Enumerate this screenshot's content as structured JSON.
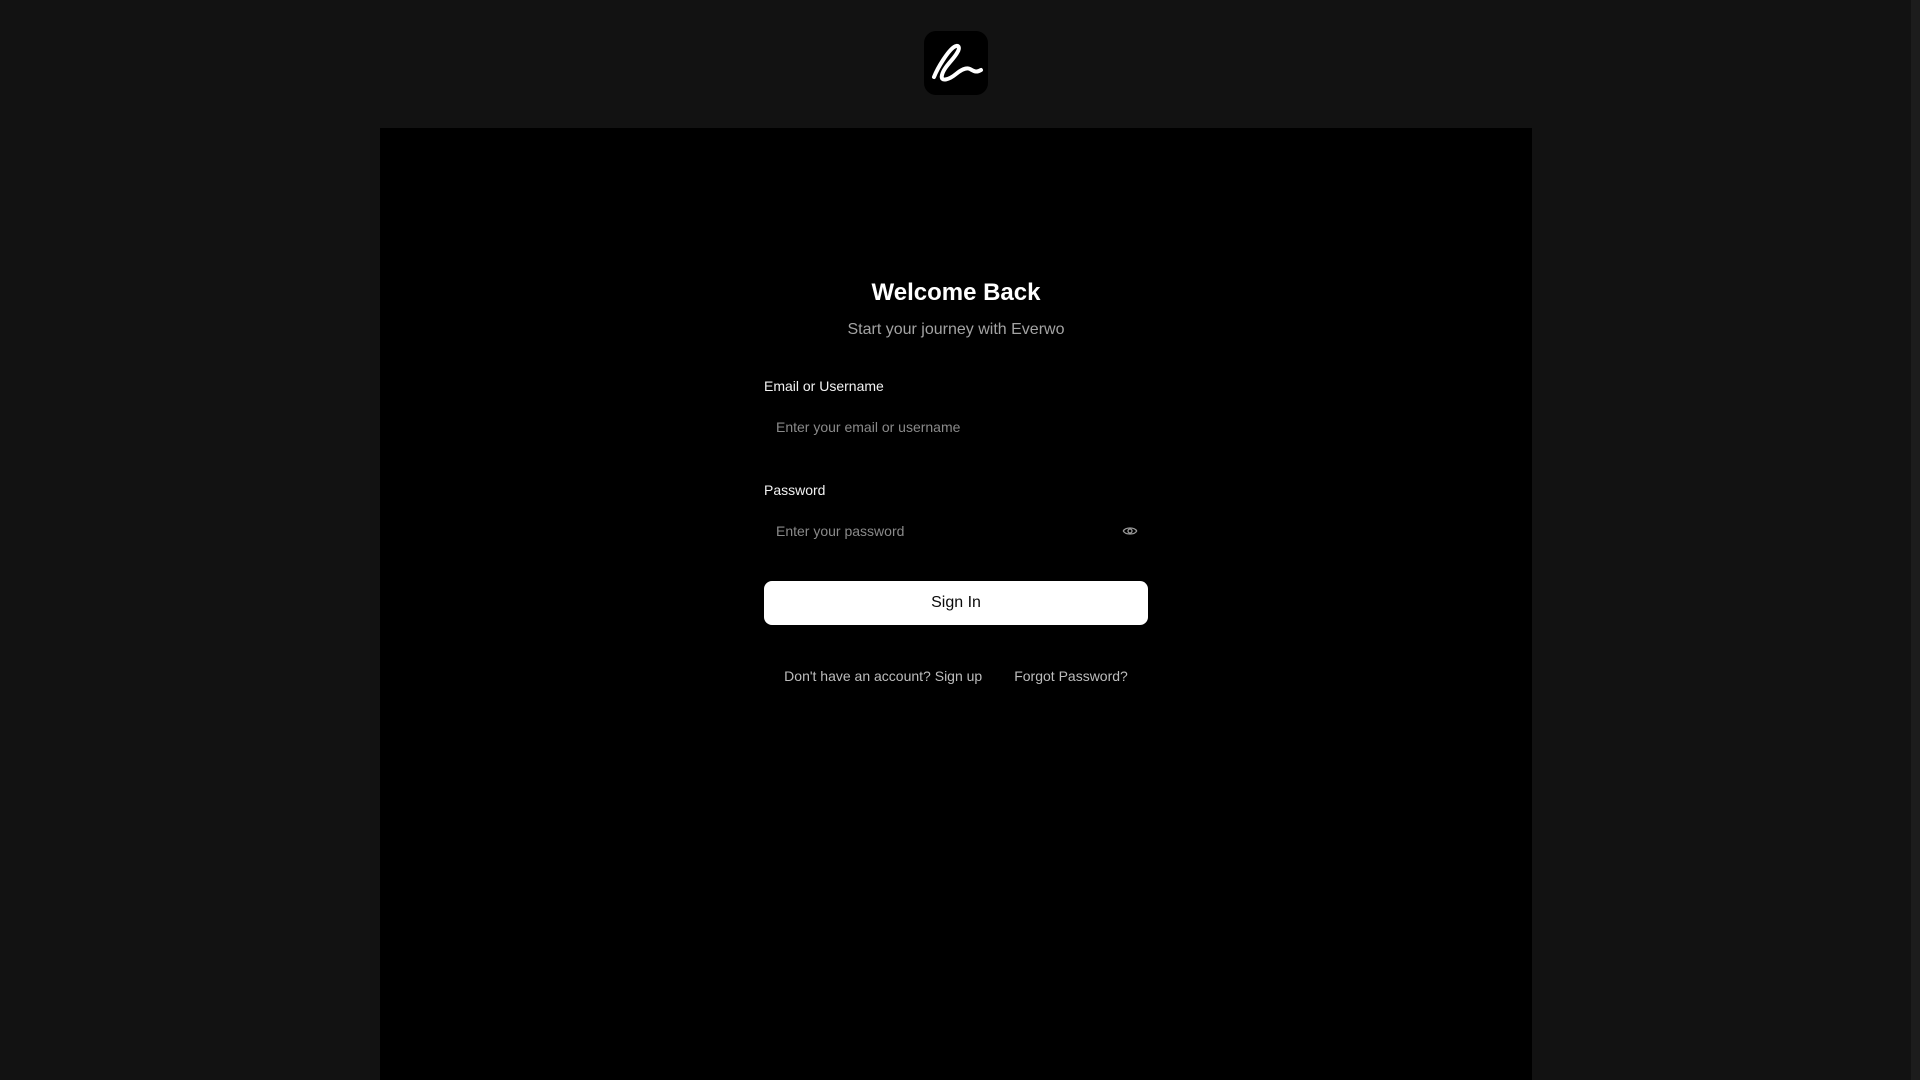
{
  "brand": {
    "logo_icon": "signature-e-icon"
  },
  "login": {
    "title": "Welcome Back",
    "subtitle": "Start your journey with Everwo",
    "email_label": "Email or Username",
    "email_placeholder": "Enter your email or username",
    "email_value": "",
    "password_label": "Password",
    "password_placeholder": "Enter your password",
    "password_value": "",
    "password_toggle_icon": "eye-icon",
    "signin_label": "Sign In",
    "signup_link": "Don't have an account? Sign up",
    "forgot_link": "Forgot Password?"
  },
  "colors": {
    "page_background": "#121212",
    "panel_background": "#000000",
    "primary_button": "#ffffff",
    "primary_button_text": "#0a0a0a",
    "muted_text": "#a3a3a3"
  }
}
